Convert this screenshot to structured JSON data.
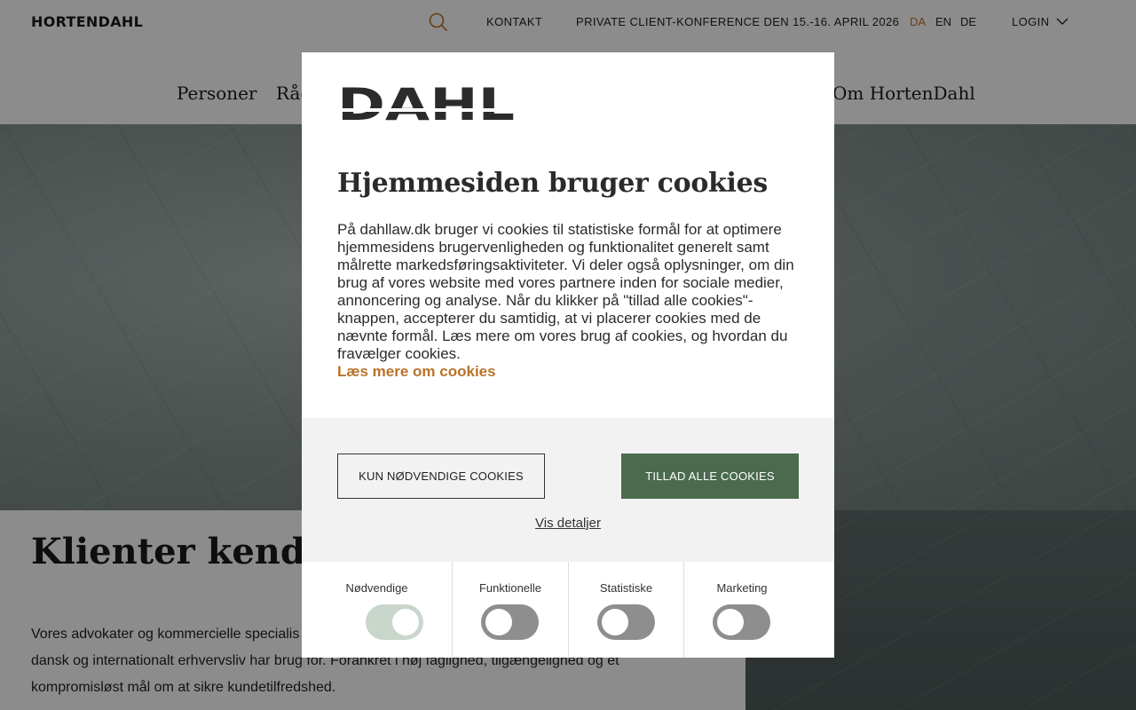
{
  "header": {
    "logo_text": "HORTENDAHL",
    "util_links": [
      "KONTAKT",
      "PRIVATE CLIENT-KONFERENCE DEN 15.-16. APRIL 2026"
    ],
    "languages": [
      "DA",
      "EN",
      "DE"
    ],
    "active_language": "DA",
    "login_label": "LOGIN",
    "accent_color": "#b8732a"
  },
  "main_nav": {
    "items": [
      "Personer",
      "Råd",
      "Om HortenDahl"
    ]
  },
  "page": {
    "heading": "Klienter kender o",
    "intro_line_1": "Vores advokater og kommercielle specialis",
    "intro_line_2": "dansk og internationalt erhvervsliv har brug for. Forankret i høj faglighed, tilgængelighed og et",
    "intro_line_3": "kompromisløst mål om at sikre kundetilfredshed."
  },
  "cookie_modal": {
    "logo_text": "DAHL",
    "title": "Hjemmesiden bruger cookies",
    "body": "På dahllaw.dk bruger vi cookies til statistiske formål for at optimere hjemmesidens brugervenligheden og funktionalitet generelt samt målrette markedsføringsaktiviteter. Vi deler også oplysninger, om din brug af vores website med vores partnere inden for sociale medier, annoncering og analyse. Når du klikker på \"tillad alle cookies\"-knappen, accepterer du samtidig, at vi placerer cookies med de nævnte formål. Læs mere om vores brug af cookies, og hvordan du fravælger cookies.",
    "read_more_link": "Læs mere om cookies",
    "btn_necessary": "KUN NØDVENDIGE COOKIES",
    "btn_allow_all": "TILLAD ALLE COOKIES",
    "details_link": "Vis detaljer",
    "button_color": "#4a6b4d",
    "categories": [
      {
        "label": "Nødvendige",
        "enabled": true
      },
      {
        "label": "Funktionelle",
        "enabled": false
      },
      {
        "label": "Statistiske",
        "enabled": false
      },
      {
        "label": "Marketing",
        "enabled": false
      }
    ]
  }
}
